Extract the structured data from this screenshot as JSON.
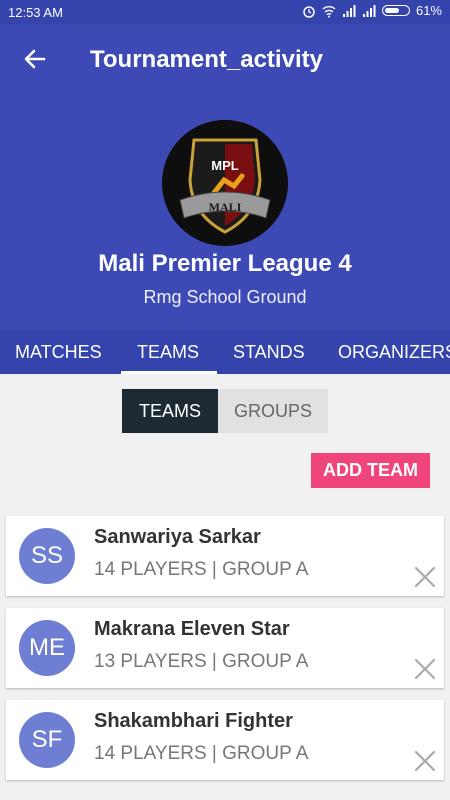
{
  "status_bar": {
    "time": "12:53 AM",
    "battery_pct": "61%"
  },
  "appbar": {
    "title": "Tournament_activity"
  },
  "tournament": {
    "logo_label": "MPL",
    "logo_banner": "MALI",
    "name": "Mali Premier League 4",
    "venue": "Rmg School Ground"
  },
  "tabs": [
    {
      "label": "MATCHES"
    },
    {
      "label": "TEAMS"
    },
    {
      "label": "STANDS"
    },
    {
      "label": "ORGANIZERS"
    }
  ],
  "segment": {
    "teams": "TEAMS",
    "groups": "GROUPS"
  },
  "add_team_label": "ADD TEAM",
  "teams": [
    {
      "initials": "SS",
      "name": "Sanwariya Sarkar",
      "meta": "14 PLAYERS | GROUP A"
    },
    {
      "initials": "ME",
      "name": "Makrana Eleven Star",
      "meta": "13 PLAYERS | GROUP A"
    },
    {
      "initials": "SF",
      "name": "Shakambhari Fighter",
      "meta": "14 PLAYERS | GROUP A"
    }
  ],
  "colors": {
    "primary": "#3d4ab6",
    "primary_dark": "#3543ad",
    "accent": "#f0457a",
    "avatar": "#6e7fd3"
  }
}
